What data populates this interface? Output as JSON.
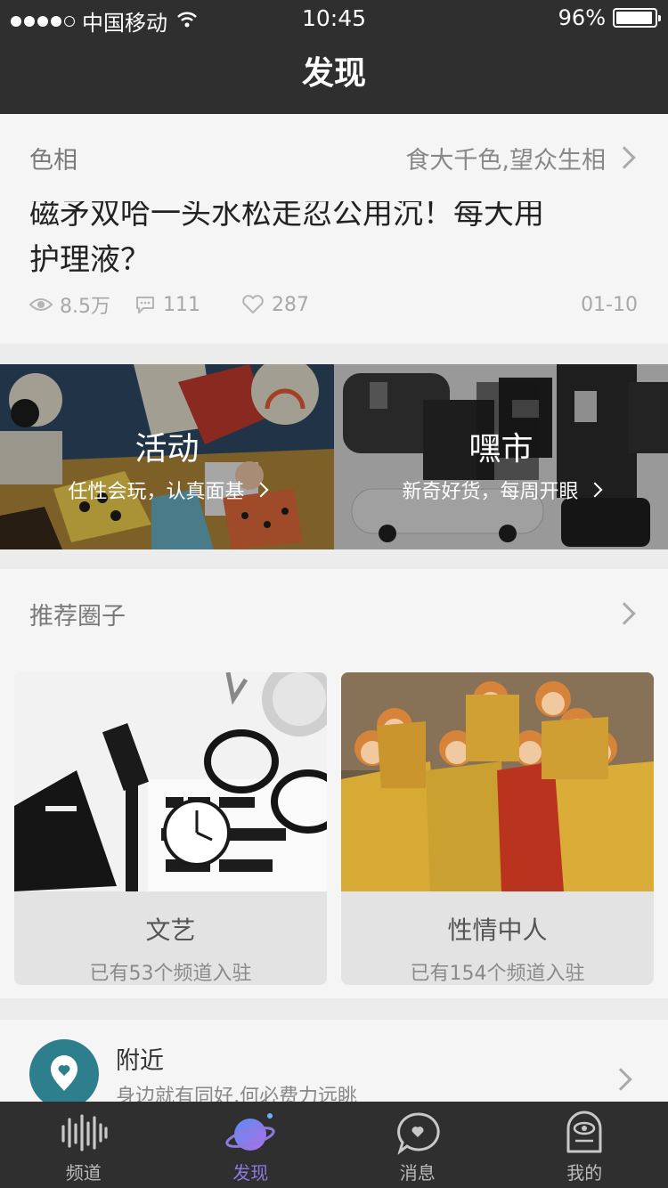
{
  "status": {
    "carrier": "中国移动",
    "time": "10:45",
    "battery": "96%",
    "battery_level": 0.96
  },
  "nav": {
    "title": "发现"
  },
  "hue": {
    "section_title": "色相",
    "more_label": "食大千色,望众生相",
    "article_title_partial": "磁矛双哈一头水松走忍公用沉！每大用",
    "article_title_end": "护理液？",
    "views": "8.5万",
    "comments": "111",
    "likes": "287",
    "date": "01-10"
  },
  "banners": [
    {
      "title": "活动",
      "subtitle": "任性会玩，认真面基"
    },
    {
      "title": "嘿市",
      "subtitle": "新奇好货，每周开眼"
    }
  ],
  "circles": {
    "section_title": "推荐圈子",
    "items": [
      {
        "name": "文艺",
        "count": "已有53个频道入驻"
      },
      {
        "name": "性情中人",
        "count": "已有154个频道入驻"
      }
    ]
  },
  "nearby": {
    "title": "附近",
    "subtitle": "身边就有同好,何必费力远眺"
  },
  "tabs": [
    {
      "label": "频道",
      "icon": "soundwave-icon"
    },
    {
      "label": "发现",
      "icon": "planet-icon",
      "active": true
    },
    {
      "label": "消息",
      "icon": "chat-bubble-icon"
    },
    {
      "label": "我的",
      "icon": "profile-robot-icon"
    }
  ],
  "colors": {
    "bar": "#2f2f2f",
    "accent": "#8f7ae0",
    "pin": "#2e7f8d"
  }
}
